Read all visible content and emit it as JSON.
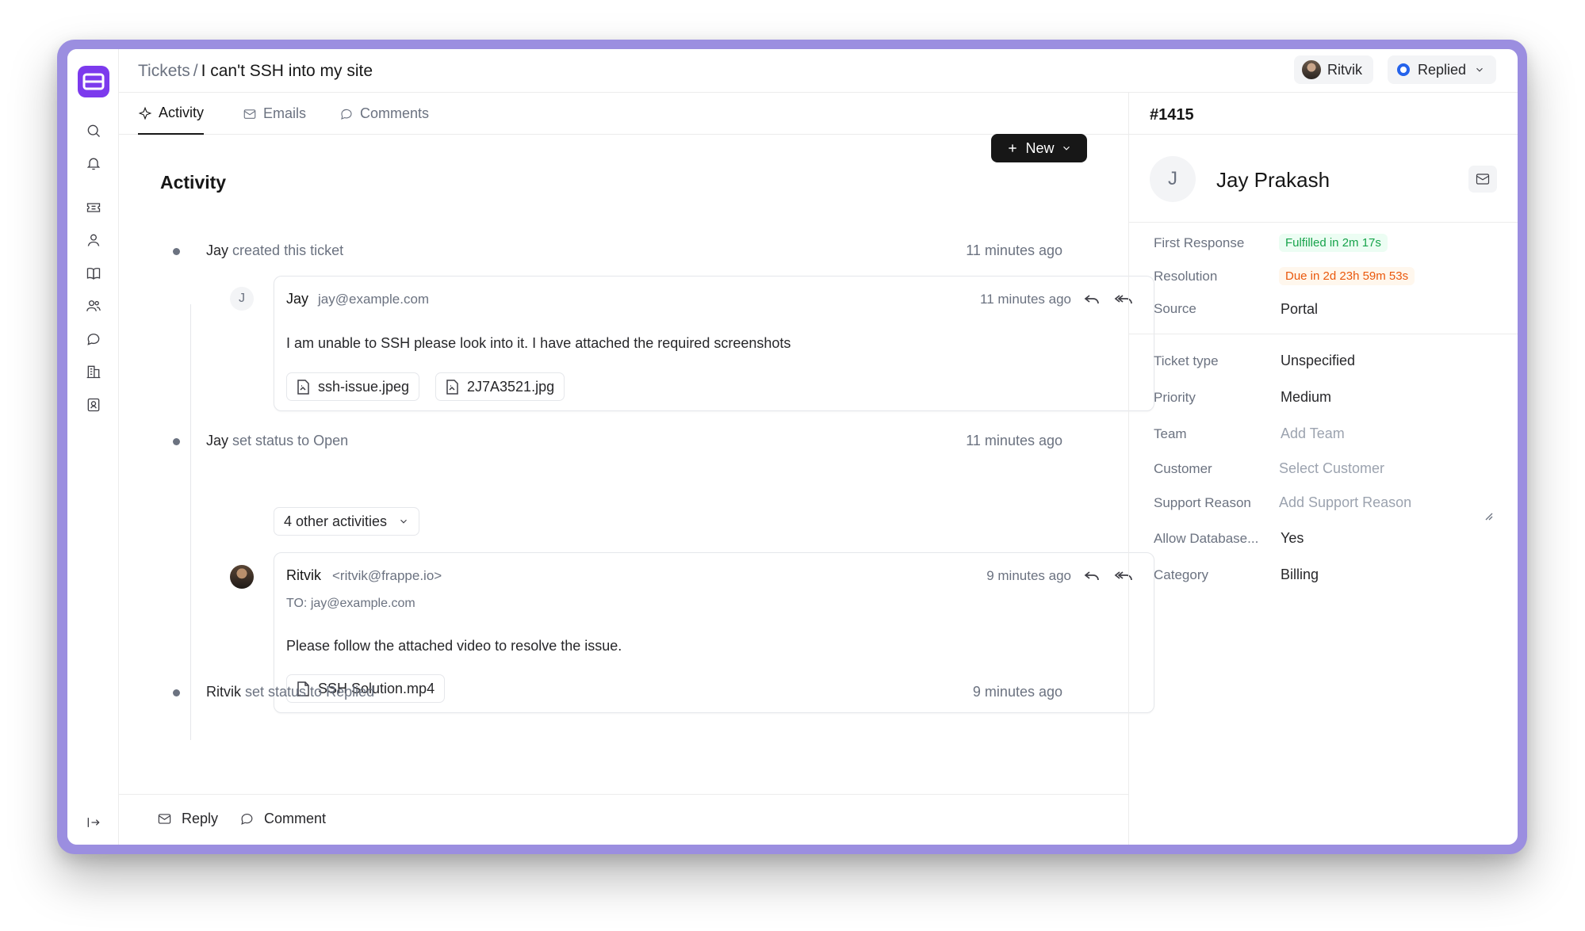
{
  "header": {
    "breadcrumb_parent": "Tickets",
    "breadcrumb_separator": "/",
    "breadcrumb_current": "I can't SSH into my site",
    "assignee": "Ritvik",
    "status": "Replied"
  },
  "tabs": [
    {
      "label": "Activity",
      "icon": "activity-icon",
      "active": true
    },
    {
      "label": "Emails",
      "icon": "mail-icon",
      "active": false
    },
    {
      "label": "Comments",
      "icon": "comment-icon",
      "active": false
    }
  ],
  "activity": {
    "title": "Activity",
    "new_button": "New",
    "events": [
      {
        "actor": "Jay",
        "action": "created this ticket",
        "time": "11 minutes ago"
      },
      {
        "actor": "Jay",
        "action": "set status to Open",
        "time": "11 minutes ago"
      },
      {
        "actor": "Ritvik",
        "action": "set status to Replied",
        "time": "9 minutes ago"
      }
    ],
    "collapsed_label": "4 other activities",
    "emails": [
      {
        "avatar_letter": "J",
        "sender": "Jay",
        "sender_email": "jay@example.com",
        "time": "11 minutes ago",
        "body": "I am unable to SSH please look into it. I have attached the required screenshots",
        "attachments": [
          "ssh-issue.jpeg",
          "2J7A3521.jpg"
        ]
      },
      {
        "sender": "Ritvik",
        "sender_email": "<ritvik@frappe.io>",
        "to_label": "TO:",
        "to": "jay@example.com",
        "time": "9 minutes ago",
        "body": "Please follow the attached video to resolve the issue.",
        "attachments": [
          "SSH Solution.mp4"
        ]
      }
    ]
  },
  "bottom_bar": {
    "reply": "Reply",
    "comment": "Comment"
  },
  "panel": {
    "ticket_id": "#1415",
    "contact_initial": "J",
    "contact_name": "Jay Prakash",
    "sla": [
      {
        "label": "First Response",
        "value": "Fulfilled in 2m 17s",
        "tone": "green"
      },
      {
        "label": "Resolution",
        "value": "Due in 2d 23h 59m 53s",
        "tone": "orange"
      },
      {
        "label": "Source",
        "value": "Portal"
      }
    ],
    "fields": [
      {
        "label": "Ticket type",
        "value": "Unspecified"
      },
      {
        "label": "Priority",
        "value": "Medium"
      },
      {
        "label": "Team",
        "placeholder": "Add Team"
      },
      {
        "label": "Customer",
        "placeholder": "Select Customer"
      },
      {
        "label": "Support Reason",
        "placeholder": "Add Support Reason"
      },
      {
        "label": "Allow Database...",
        "value": "Yes"
      },
      {
        "label": "Category",
        "value": "Billing"
      }
    ]
  },
  "colors": {
    "brand": "#7c3aed",
    "frame": "#9b8ee0",
    "status": "#2563eb"
  }
}
